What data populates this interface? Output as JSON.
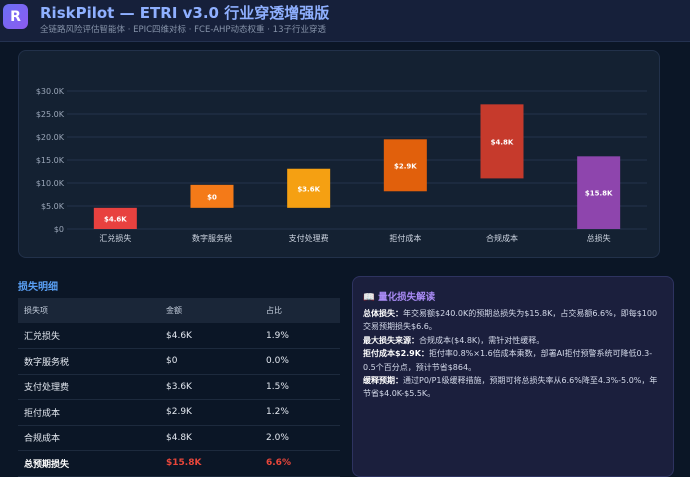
{
  "header": {
    "logo_letter": "R",
    "title": "RiskPilot — ETRI v3.0 行业穿透增强版",
    "subtitle": "全链路风险评估智能体 · EPIC四维对标 · FCE-AHP动态权重 · 13子行业穿透"
  },
  "chart_data": {
    "type": "bar",
    "subtype": "waterfall",
    "categories": [
      "汇兑损失",
      "数字服务税",
      "支付处理费",
      "拒付成本",
      "合规成本",
      "总损失"
    ],
    "value_labels": [
      "$4.6K",
      "$0",
      "$3.6K",
      "$2.9K",
      "$4.8K",
      "$15.8K"
    ],
    "bars": [
      {
        "start": 0,
        "end": 4.6
      },
      {
        "start": 4.6,
        "end": 9.6
      },
      {
        "start": 4.6,
        "end": 13.1
      },
      {
        "start": 8.2,
        "end": 19.5
      },
      {
        "start": 11.0,
        "end": 27.1
      },
      {
        "start": 0,
        "end": 15.8
      }
    ],
    "colors": [
      "#e8413f",
      "#f47a18",
      "#f5a012",
      "#e1600c",
      "#c63a2c",
      "#8e45ad"
    ],
    "yticks": [
      "$0",
      "$5.0K",
      "$10.0K",
      "$15.0K",
      "$20.0K",
      "$25.0K",
      "$30.0K"
    ],
    "ylim": [
      0,
      30
    ],
    "grid": true,
    "legend": "none"
  },
  "table": {
    "section_title": "损失明细",
    "headers": [
      "损失项",
      "金额",
      "占比"
    ],
    "rows": [
      [
        "汇兑损失",
        "$4.6K",
        "1.9%"
      ],
      [
        "数字服务税",
        "$0",
        "0.0%"
      ],
      [
        "支付处理费",
        "$3.6K",
        "1.5%"
      ],
      [
        "拒付成本",
        "$2.9K",
        "1.2%"
      ],
      [
        "合规成本",
        "$4.8K",
        "2.0%"
      ]
    ],
    "total": [
      "总预期损失",
      "$15.8K",
      "6.6%"
    ]
  },
  "insight": {
    "icon": "📖",
    "title": "量化损失解读",
    "paragraphs": [
      {
        "label": "总体损失：",
        "text": "年交易额$240.0K的预期总损失为$15.8K，占交易额6.6%，即每$100交易预期损失$6.6。"
      },
      {
        "label": "最大损失来源：",
        "text": "合规成本($4.8K)，需针对性缓释。"
      },
      {
        "label": "拒付成本$2.9K：",
        "text": "拒付率0.8%×1.6倍成本乘数，部署AI拒付预警系统可降低0.3-0.5个百分点，预计节省$864。"
      },
      {
        "label": "缓释预期：",
        "text": "通过P0/P1级缓释措施，预期可将总损失率从6.6%降至4.3%-5.0%，年节省$4.0K-$5.5K。"
      }
    ]
  },
  "colors": {
    "background": "#0b1626",
    "accent": "#5aa0f5",
    "danger": "#e8463a",
    "purple": "#a98bf5"
  }
}
